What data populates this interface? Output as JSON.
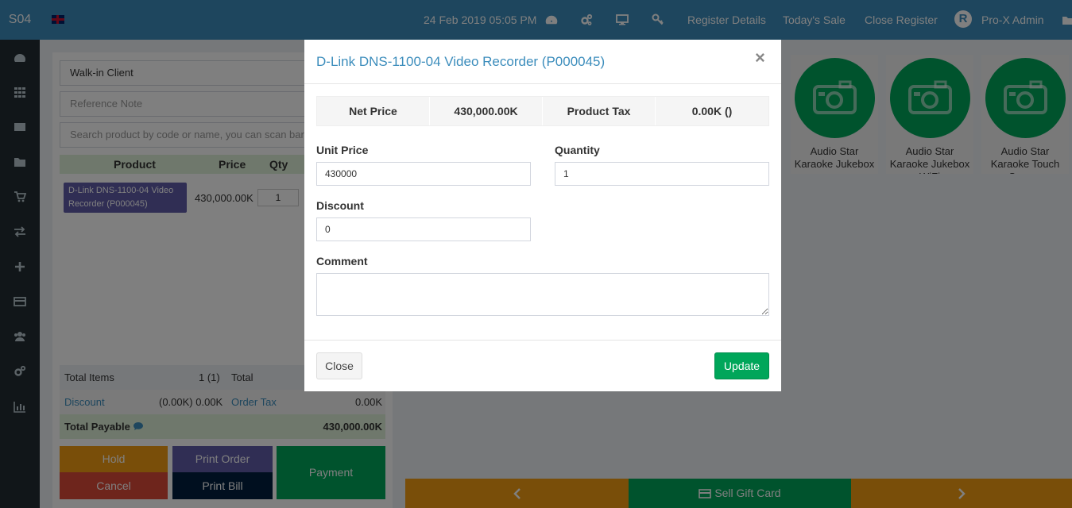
{
  "header": {
    "brand": "S04",
    "datetime": "24 Feb 2019 05:05 PM",
    "links": [
      "Register Details",
      "Today's Sale",
      "Close Register"
    ],
    "avatar_letter": "R",
    "user": "Pro-X Admin"
  },
  "pos": {
    "customer": "Walk-in Client",
    "reference_placeholder": "Reference Note",
    "search_placeholder": "Search product by code or name, you can scan barcode too",
    "columns": [
      "Product",
      "Price",
      "Qty"
    ],
    "item": {
      "name": "D-Link DNS-1100-04 Video Recorder (P000045)",
      "price": "430,000.00K",
      "qty": "1"
    },
    "totals": {
      "total_items_label": "Total Items",
      "total_items_value": "1 (1)",
      "total_label": "Total",
      "discount_label": "Discount",
      "discount_value": "(0.00K) 0.00K",
      "order_tax_label": "Order Tax",
      "order_tax_value": "0.00K",
      "total_payable_label": "Total Payable",
      "total_payable_value": "430,000.00K"
    },
    "buttons": {
      "hold": "Hold",
      "print_order": "Print Order",
      "payment": "Payment",
      "cancel": "Cancel",
      "print_bill": "Print Bill"
    }
  },
  "products": [
    {
      "name": "Audio Star Karaoke Jukebox"
    },
    {
      "name": "Audio Star Karaoke Jukebox WiFi"
    },
    {
      "name": "Audio Star Karaoke Touch Screen"
    }
  ],
  "bottom_bar": {
    "gift_card": "Sell Gift Card"
  },
  "modal": {
    "title": "D-Link DNS-1100-04 Video Recorder (P000045)",
    "close_icon": "×",
    "info": {
      "net_price_label": "Net Price",
      "net_price_value": "430,000.00K",
      "tax_label": "Product Tax",
      "tax_value": "0.00K ()"
    },
    "unit_price_label": "Unit Price",
    "unit_price_value": "430000",
    "quantity_label": "Quantity",
    "quantity_value": "1",
    "discount_label": "Discount",
    "discount_value": "0",
    "comment_label": "Comment",
    "comment_value": "",
    "close_button": "Close",
    "update_button": "Update"
  },
  "colors": {
    "primary": "#3c8dbc",
    "success": "#00a65a",
    "warning": "#f39c12",
    "danger": "#dd4b39",
    "purple": "#605ca8",
    "navy": "#001f3f",
    "sidebar": "#222d32"
  }
}
